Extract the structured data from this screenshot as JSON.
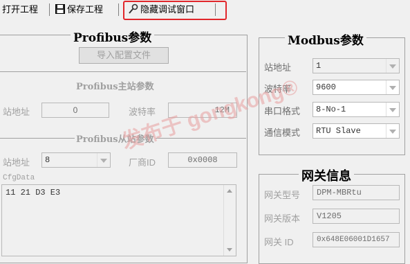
{
  "toolbar": {
    "open_project": "打开工程",
    "save_project": "保存工程",
    "hide_debug": "隐藏调试窗口"
  },
  "profibus": {
    "title": "Profibus参数",
    "import_button": "导入配置文件",
    "master_title": "Profibus主站参数",
    "master_addr_label": "站地址",
    "master_addr_value": "0",
    "baud_label": "波特率",
    "baud_value": "12M",
    "slave_title": "Profibus从站参数",
    "slave_addr_label": "站地址",
    "slave_addr_value": "8",
    "vendor_id_label": "厂商ID",
    "vendor_id_value": "0x0008",
    "cfgdata_label": "CfgData",
    "cfgdata_value": "11 21 D3 E3"
  },
  "modbus": {
    "title": "Modbus参数",
    "addr_label": "站地址",
    "addr_value": "1",
    "baud_label": "波特率",
    "baud_value": "9600",
    "port_label": "串口格式",
    "port_value": "8-No-1",
    "mode_label": "通信模式",
    "mode_value": "RTU Slave"
  },
  "gateway": {
    "title": "网关信息",
    "model_label": "网关型号",
    "model_value": "DPM-MBRtu",
    "version_label": "网关版本",
    "version_value": "V1205",
    "id_label": "网关 ID",
    "id_value": "0x648E06001D1657"
  },
  "watermark": "发布于 gongkong®"
}
